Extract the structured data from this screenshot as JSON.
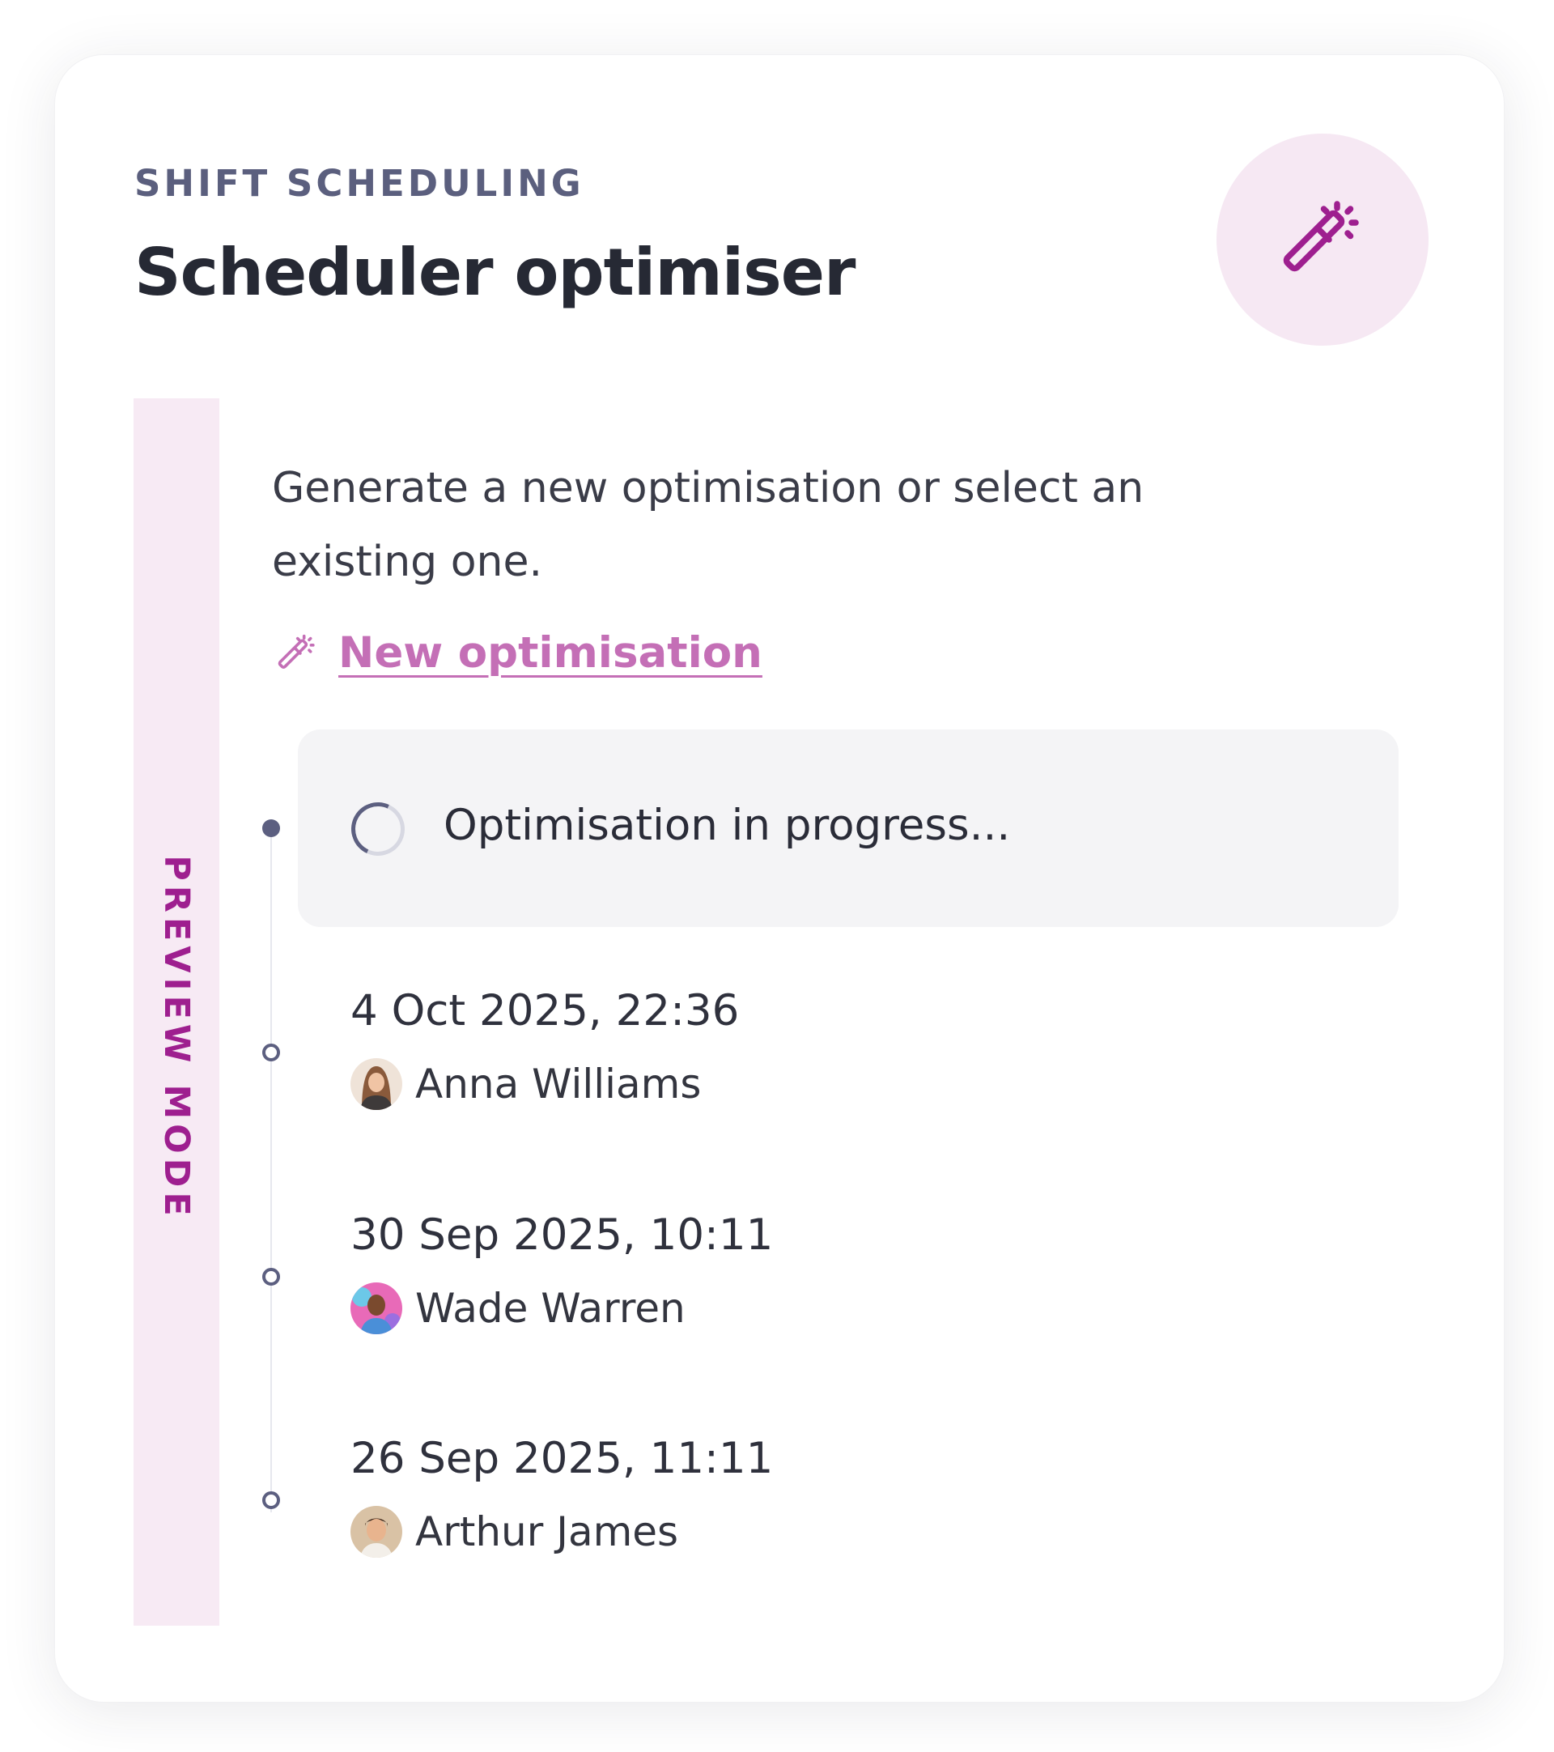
{
  "header": {
    "eyebrow": "SHIFT SCHEDULING",
    "title": "Scheduler optimiser",
    "icon": "magic-wand-icon",
    "icon_bg_color": "#f6e8f3",
    "icon_color": "#9e1f8f"
  },
  "preview_badge": {
    "label": "PREVIEW MODE",
    "color": "#9e1f8f",
    "bg_color": "#f7eaf4"
  },
  "description": "Generate a new optimisation or select an existing one.",
  "new_optimisation": {
    "label": "New optimisation",
    "icon": "magic-wand-icon",
    "color": "#c46fb6"
  },
  "progress": {
    "label": "Optimisation in progress...",
    "icon": "spinner-icon"
  },
  "history": [
    {
      "date": "4 Oct 2025, 22:36",
      "user": "Anna Williams"
    },
    {
      "date": "30 Sep 2025, 10:11",
      "user": "Wade Warren"
    },
    {
      "date": "26 Sep 2025, 11:11",
      "user": "Arthur James"
    }
  ]
}
